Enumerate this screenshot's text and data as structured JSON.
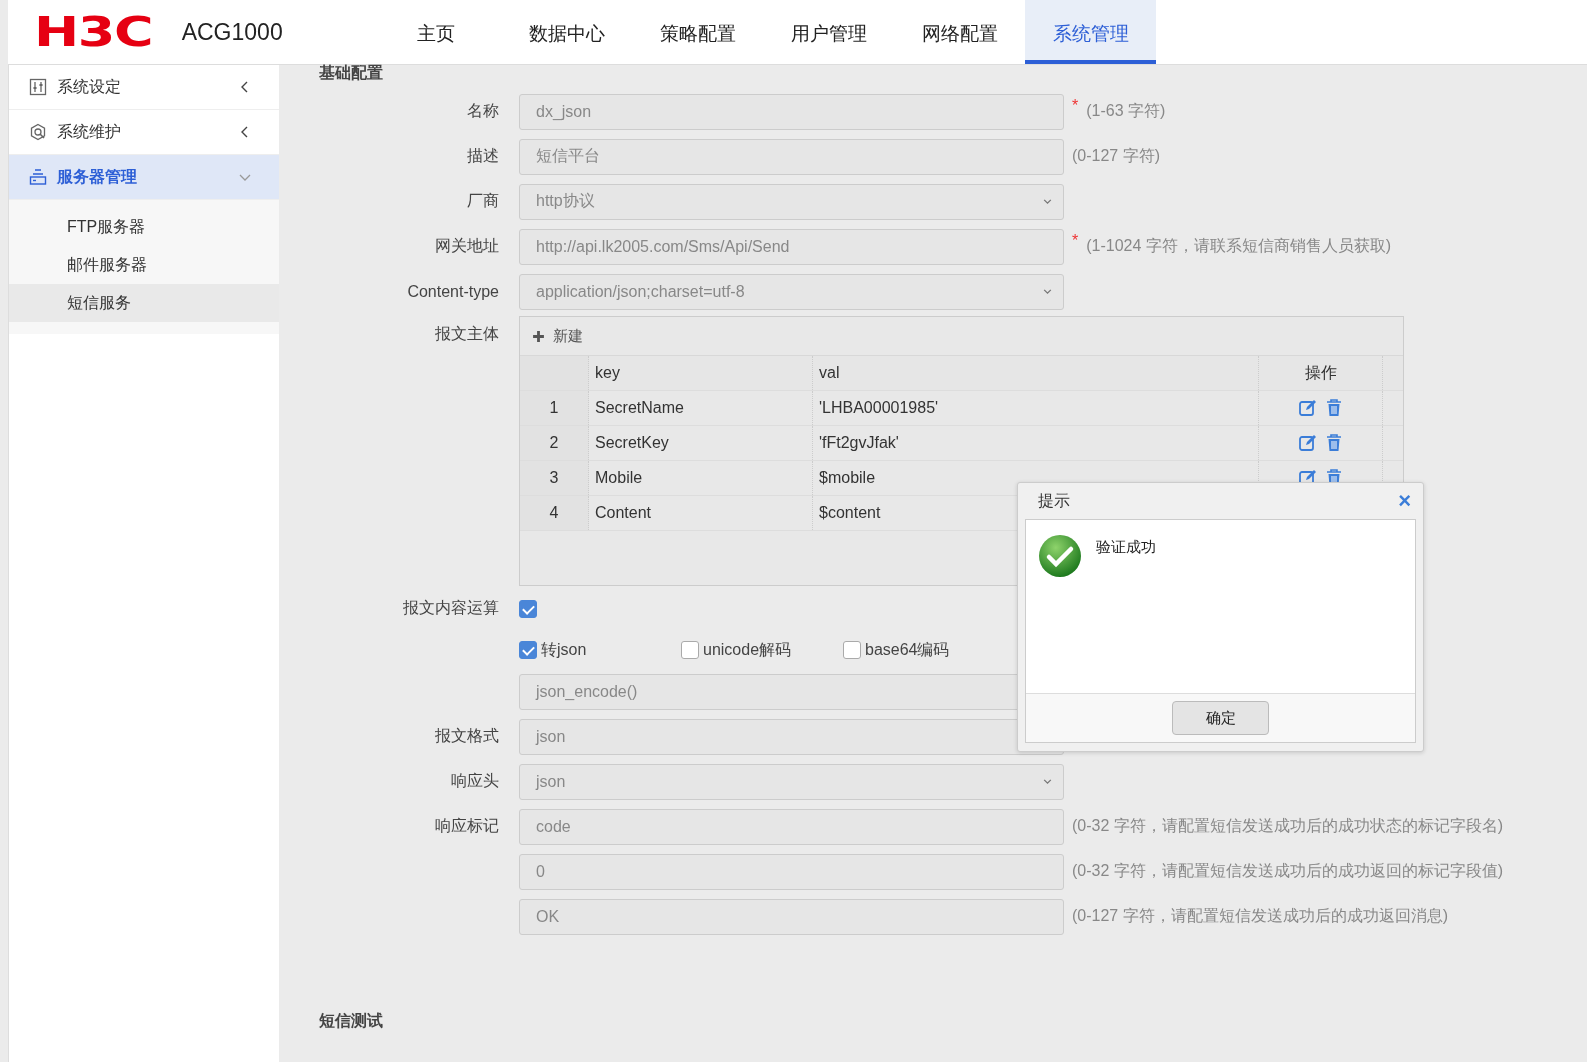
{
  "header": {
    "logo": "H3C",
    "product": "ACG1000",
    "nav": [
      {
        "label": "主页",
        "selected": false
      },
      {
        "label": "数据中心",
        "selected": false
      },
      {
        "label": "策略配置",
        "selected": false
      },
      {
        "label": "用户管理",
        "selected": false
      },
      {
        "label": "网络配置",
        "selected": false
      },
      {
        "label": "系统管理",
        "selected": true
      }
    ]
  },
  "sidebar": {
    "items": [
      {
        "label": "系统设定",
        "expanded": false
      },
      {
        "label": "系统维护",
        "expanded": false
      },
      {
        "label": "服务器管理",
        "expanded": true,
        "children": [
          {
            "label": "FTP服务器",
            "selected": false
          },
          {
            "label": "邮件服务器",
            "selected": false
          },
          {
            "label": "短信服务",
            "selected": true
          }
        ]
      }
    ]
  },
  "section_title": "基础配置",
  "fields_top": [
    {
      "label": "名称",
      "kind": "input",
      "value": "dx_json",
      "required_mark": "*",
      "hint": "(1-63 字符)"
    },
    {
      "label": "描述",
      "kind": "input",
      "value": "短信平台",
      "hint": "(0-127 字符)"
    },
    {
      "label": "厂商",
      "kind": "select",
      "value": "http协议"
    },
    {
      "label": "网关地址",
      "kind": "input",
      "value": "http://api.lk2005.com/Sms/Api/Send",
      "required_mark": "*",
      "hint": "(1-1024 字符，请联系短信商销售人员获取)"
    },
    {
      "label": "Content-type",
      "kind": "select",
      "value": "application/json;charset=utf-8"
    }
  ],
  "body_table": {
    "label": "报文主体",
    "add_button": "新建",
    "columns": [
      "key",
      "val",
      "操作"
    ],
    "rows": [
      {
        "index": "1",
        "key": "SecretName",
        "val": "'LHBA00001985'"
      },
      {
        "index": "2",
        "key": "SecretKey",
        "val": "'fFt2gvJfak'"
      },
      {
        "index": "3",
        "key": "Mobile",
        "val": "$mobile"
      },
      {
        "index": "4",
        "key": "Content",
        "val": "$content"
      }
    ]
  },
  "content_ops": {
    "label": "报文内容运算",
    "checked": true,
    "options": [
      {
        "label": "转json",
        "checked": true
      },
      {
        "label": "unicode解码",
        "checked": false
      },
      {
        "label": "base64编码",
        "checked": false
      }
    ],
    "function": "json_encode()"
  },
  "fields_bottom": [
    {
      "label": "报文格式",
      "kind": "input",
      "value": "json"
    },
    {
      "label": "响应头",
      "kind": "select",
      "value": "json"
    },
    {
      "label": "响应标记",
      "kind": "input",
      "value": "code",
      "hint": "(0-32 字符，请配置短信发送成功后的成功状态的标记字段名)"
    },
    {
      "kind": "input",
      "value": "0",
      "hint": "(0-32 字符，请配置短信发送成功后的成功返回的标记字段值)"
    },
    {
      "kind": "input",
      "value": "OK",
      "hint": "(0-127 字符，请配置短信发送成功后的成功返回消息)"
    }
  ],
  "section2_title": "短信测试",
  "dialog": {
    "title": "提示",
    "close": "×",
    "message": "验证成功",
    "button": "确定"
  }
}
